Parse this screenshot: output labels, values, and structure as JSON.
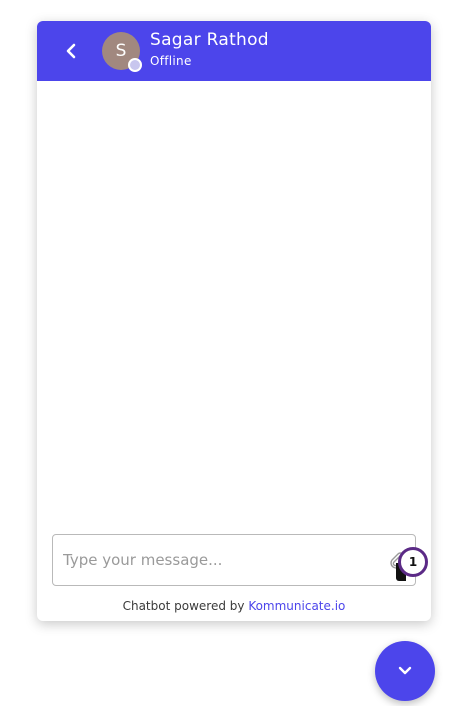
{
  "header": {
    "avatar_initial": "S",
    "contact_name": "Sagar Rathod",
    "contact_status": "Offline"
  },
  "composer": {
    "placeholder": "Type your message..."
  },
  "badge": {
    "count": "1"
  },
  "footer": {
    "prefix": "Chatbot powered by",
    "link_text": "Kommunicate.io"
  },
  "icons": {
    "back": "chevron-left-icon",
    "attach": "paperclip-icon",
    "launcher": "chevron-down-icon"
  },
  "colors": {
    "brand": "#4c45eb",
    "avatar_bg": "#a1887f",
    "badge_ring": "#5b2a86",
    "footer_text": "#3a3a3a"
  }
}
